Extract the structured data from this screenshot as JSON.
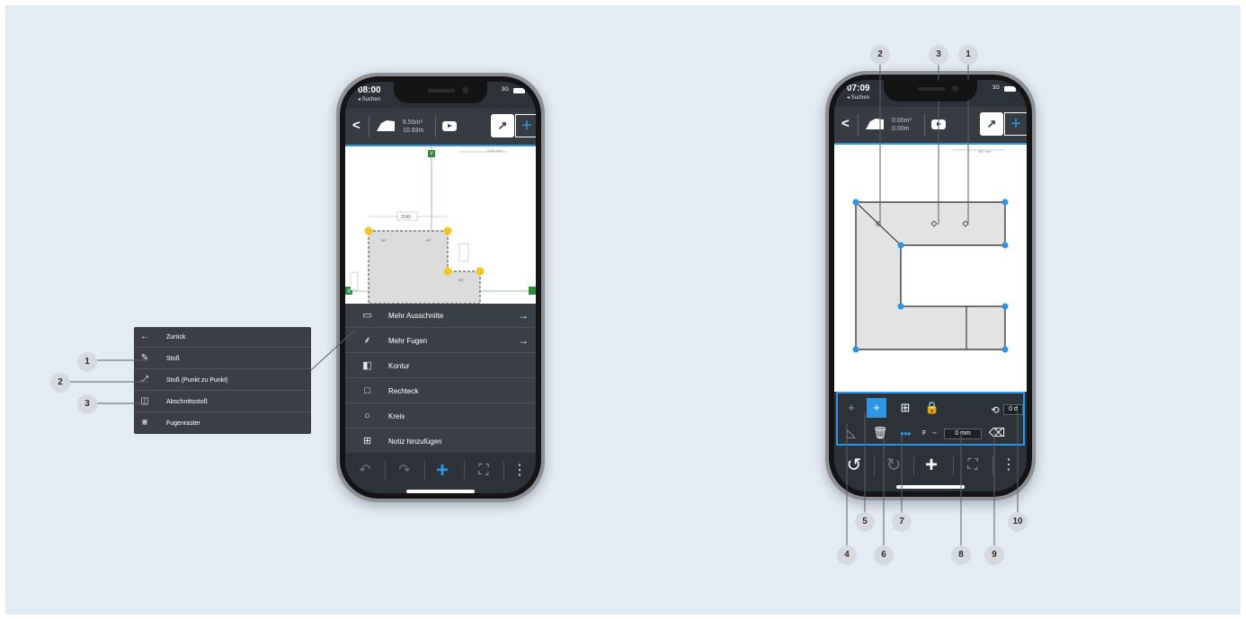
{
  "left_phone": {
    "status": {
      "time": "08:00",
      "back": "◂ Suchen",
      "network": "3G"
    },
    "appbar": {
      "area_m2": "6.55m²",
      "length": "10.93m"
    },
    "canvas": {
      "scale": "2000 mm",
      "axis_y": "Y",
      "axis_x": "X",
      "dim_top": "2045",
      "angle_a": "90°",
      "angle_b": "90°",
      "angle_c": "90°"
    },
    "menu": [
      {
        "label": "Mehr Ausschnitte",
        "icon": "folder-icon",
        "arrow": "→"
      },
      {
        "label": "Mehr Fugen",
        "icon": "joint-icon",
        "arrow": "→"
      },
      {
        "label": "Kontur",
        "icon": "contour-icon",
        "arrow": ""
      },
      {
        "label": "Rechteck",
        "icon": "rectangle-icon",
        "arrow": ""
      },
      {
        "label": "Kreis",
        "icon": "circle-icon",
        "arrow": ""
      },
      {
        "label": "Notiz hinzufügen",
        "icon": "note-icon",
        "arrow": ""
      }
    ]
  },
  "popup": {
    "items": [
      {
        "label": "Zurück",
        "icon": "arrow-left-icon"
      },
      {
        "label": "Stoß",
        "icon": "pen-icon"
      },
      {
        "label": "Stoß (Punkt zu Punkt)",
        "icon": "diagonal-line-icon"
      },
      {
        "label": "Abschnittsstoß",
        "icon": "section-joint-icon"
      },
      {
        "label": "Fugenraster",
        "icon": "joint-grid-icon"
      }
    ],
    "callouts": [
      "1",
      "2",
      "3"
    ]
  },
  "right_phone": {
    "status": {
      "time": "07:09",
      "back": "◂ Suchen",
      "network": "3G"
    },
    "appbar": {
      "area_m2": "0.00m²",
      "length": "0.00m"
    },
    "canvas": {
      "scale": "467 mm"
    },
    "toolbar": {
      "offset_label": "F",
      "offset_value": "0 mm",
      "angle_value": "0 d"
    },
    "callouts_top": [
      "2",
      "3",
      "1"
    ],
    "callouts_bottom": [
      "4",
      "5",
      "6",
      "7",
      "8",
      "9",
      "10"
    ]
  },
  "colors": {
    "accent": "#2e95e4",
    "background": "#e4ecf3",
    "dark_ui": "#2d3238",
    "vertex_yellow": "#f3c623"
  }
}
